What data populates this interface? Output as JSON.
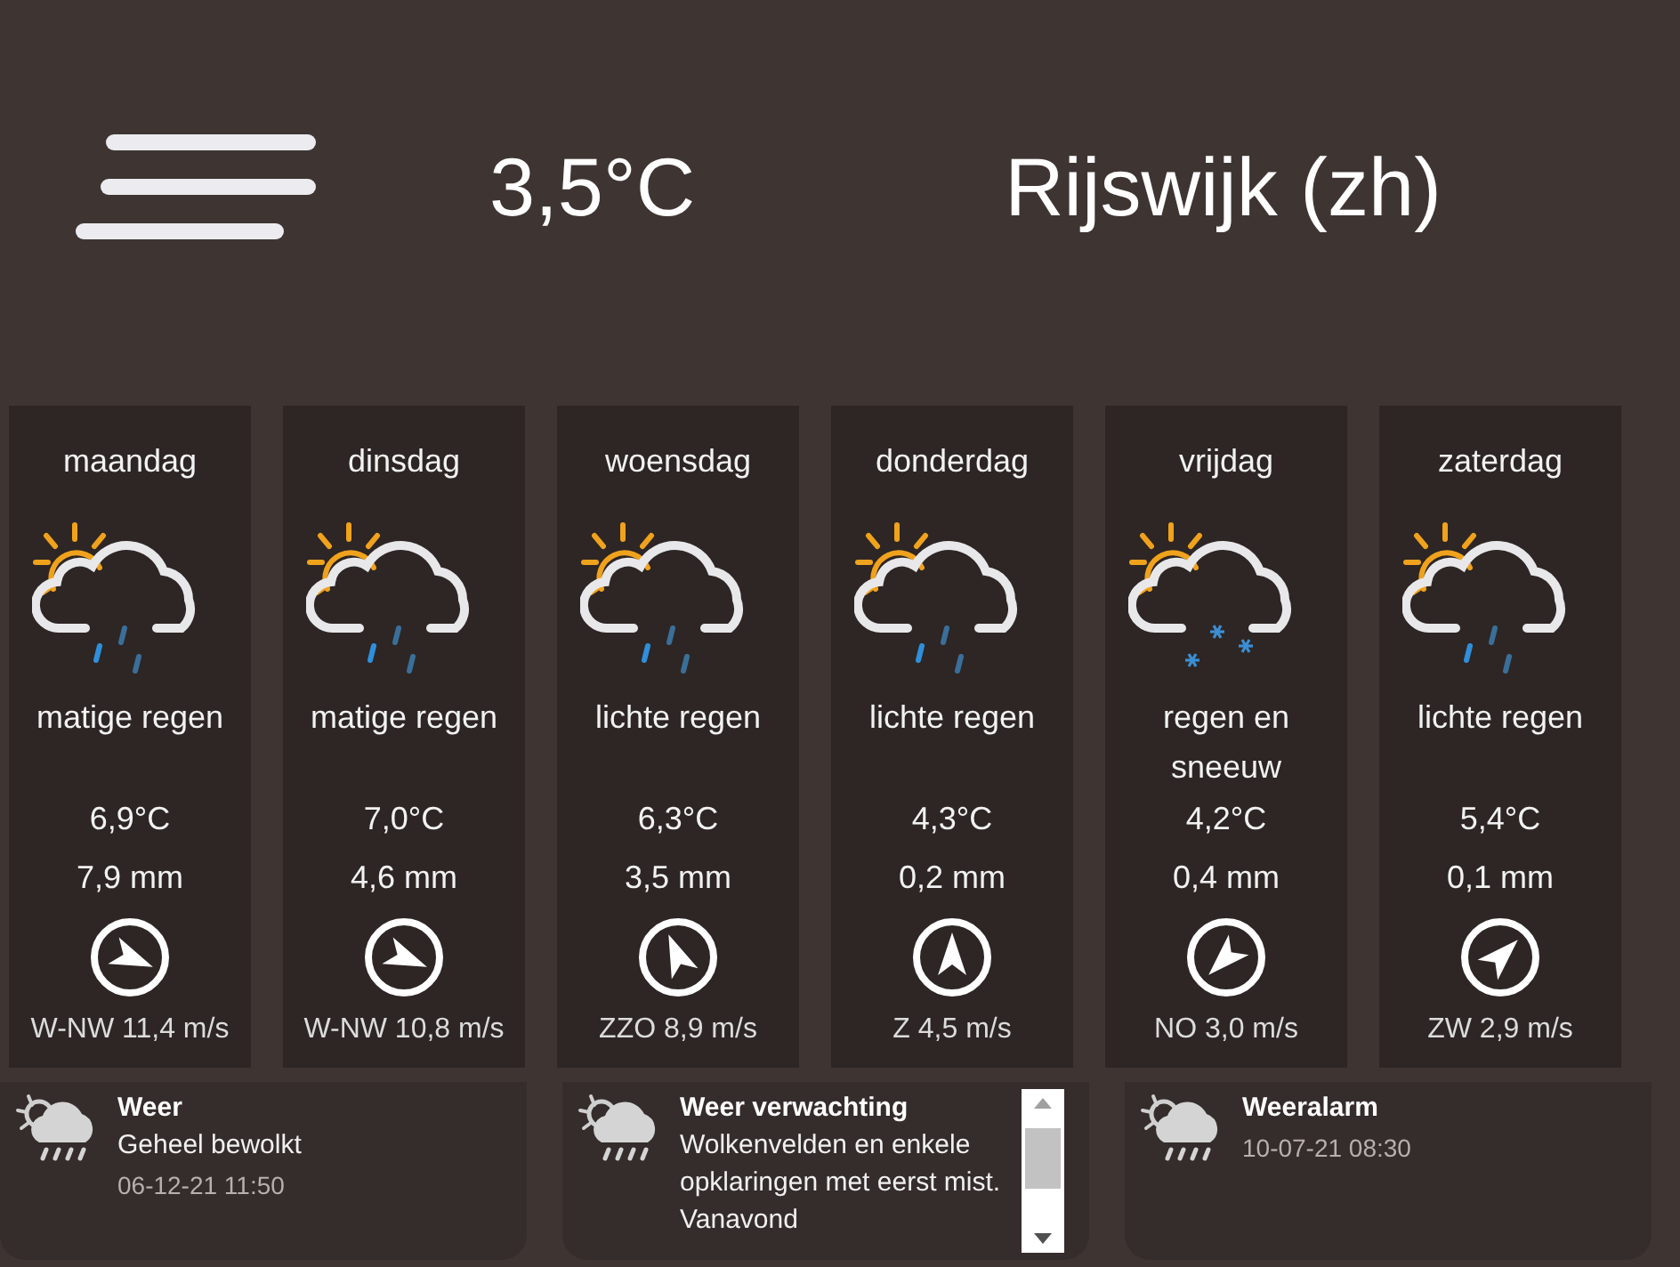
{
  "header": {
    "temperature": "3,5°C",
    "location": "Rijswijk (zh)"
  },
  "forecast": [
    {
      "day": "maandag",
      "kind": "rain",
      "description": "matige regen",
      "temperature": "6,9°C",
      "precipitation": "7,9 mm",
      "wind_arrow": {
        "kind": "ese"
      },
      "wind": "W-NW 11,4 m/s"
    },
    {
      "day": "dinsdag",
      "kind": "rain",
      "description": "matige regen",
      "temperature": "7,0°C",
      "precipitation": "4,6 mm",
      "wind_arrow": {
        "kind": "ese"
      },
      "wind": "W-NW 10,8 m/s"
    },
    {
      "day": "woensdag",
      "kind": "rain",
      "description": "lichte regen",
      "temperature": "6,3°C",
      "precipitation": "3,5 mm",
      "wind_arrow": {
        "kind": "nnw"
      },
      "wind": "ZZO 8,9 m/s"
    },
    {
      "day": "donderdag",
      "kind": "rain",
      "description": "lichte regen",
      "temperature": "4,3°C",
      "precipitation": "0,2 mm",
      "wind_arrow": {
        "kind": "n"
      },
      "wind": "Z 4,5 m/s"
    },
    {
      "day": "vrijdag",
      "kind": "snow",
      "description": "regen en sneeuw",
      "temperature": "4,2°C",
      "precipitation": "0,4 mm",
      "wind_arrow": {
        "kind": "sw"
      },
      "wind": "NO 3,0 m/s"
    },
    {
      "day": "zaterdag",
      "kind": "rain",
      "description": "lichte regen",
      "temperature": "5,4°C",
      "precipitation": "0,1 mm",
      "wind_arrow": {
        "kind": "ne"
      },
      "wind": "ZW 2,9 m/s"
    }
  ],
  "tiles": [
    {
      "title": "Weer",
      "text": "Geheel bewolkt",
      "time": "06-12-21 11:50",
      "scrollable": false
    },
    {
      "title": "Weer verwachting",
      "text": "Wolkenvelden en enkele opklaringen met eerst mist. Vanavond",
      "scrollable": true
    },
    {
      "title": "Weeralarm",
      "time": "10-07-21 08:30",
      "scrollable": false
    }
  ]
}
